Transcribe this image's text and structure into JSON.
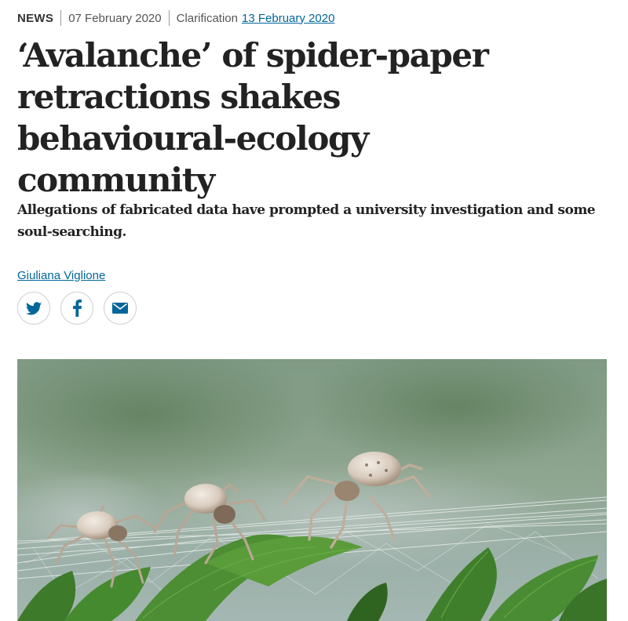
{
  "article": {
    "type": "NEWS",
    "date": "07 February 2020",
    "clarification_label": "Clarification",
    "clarification_date": "13 February 2020",
    "title": "‘Avalanche’ of spider-paper retractions shakes behavioural-ecology community",
    "standfirst": "Allegations of fabricated data have prompted a university investigation and some soul-searching.",
    "author": "Giuliana Viglione"
  },
  "share": {
    "icons": [
      "twitter-icon",
      "facebook-icon",
      "email-icon"
    ]
  },
  "colors": {
    "link": "#006699",
    "text": "#222222",
    "meta": "#555555"
  },
  "hero_image": {
    "subject": "spiders on a web over green leaves"
  }
}
